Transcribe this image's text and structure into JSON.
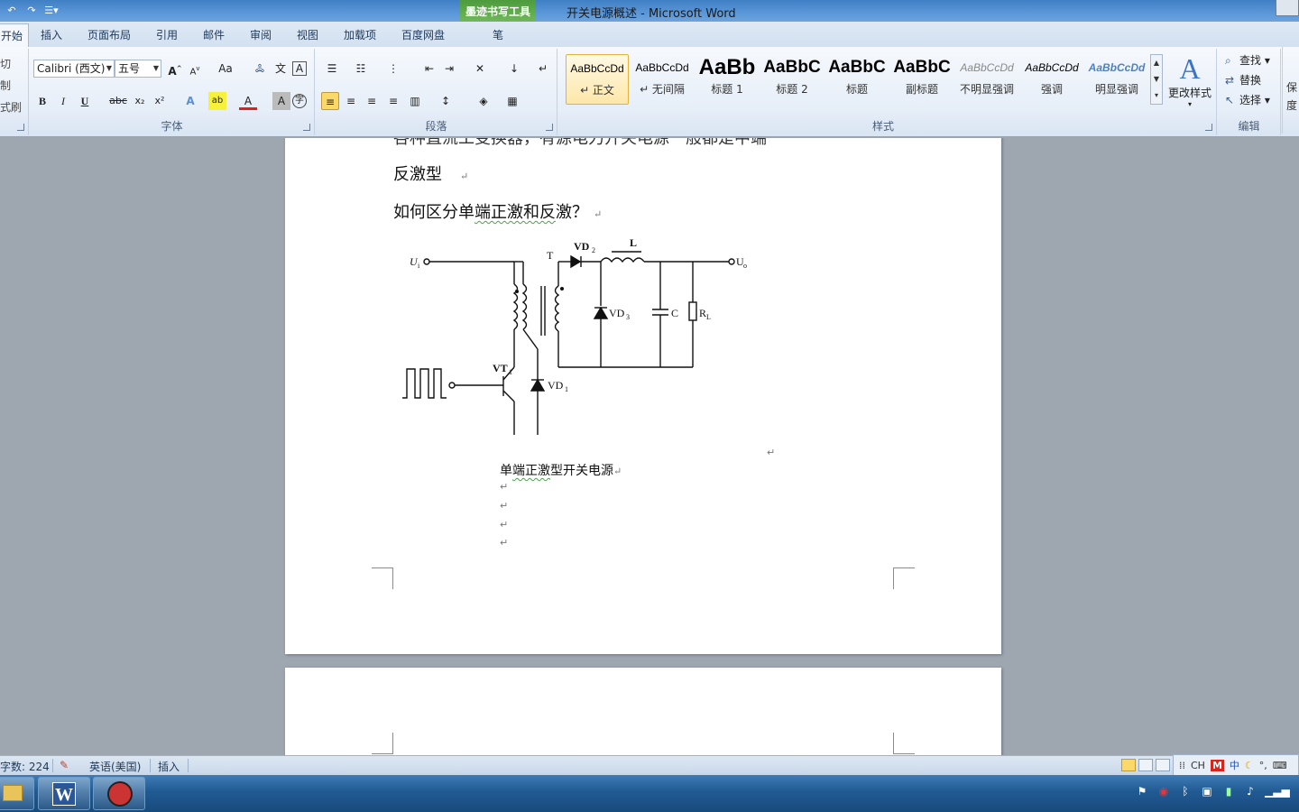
{
  "window": {
    "title": "开关电源概述 - Microsoft Word",
    "context_tool": "墨迹书写工具",
    "context_tab": "笔"
  },
  "tabs": [
    "开始",
    "插入",
    "页面布局",
    "引用",
    "邮件",
    "审阅",
    "视图",
    "加载项",
    "百度网盘"
  ],
  "clipboard": {
    "cut": "切",
    "copy": "制",
    "format_painter": "式刷"
  },
  "font": {
    "family": "Calibri (西文)",
    "size": "五号",
    "grow": "A",
    "shrink": "A",
    "case": "Aa",
    "bold": "B",
    "italic": "I",
    "underline": "U",
    "strike": "abc",
    "subscript": "x₂",
    "superscript": "x²",
    "group_label": "字体"
  },
  "paragraph": {
    "group_label": "段落"
  },
  "styles": {
    "group_label": "样式",
    "items": [
      {
        "sample": "AaBbCcDd",
        "name": "↵ 正文"
      },
      {
        "sample": "AaBbCcDd",
        "name": "↵ 无间隔"
      },
      {
        "sample": "AaBb",
        "name": "标题 1"
      },
      {
        "sample": "AaBbC",
        "name": "标题 2"
      },
      {
        "sample": "AaBbC",
        "name": "标题"
      },
      {
        "sample": "AaBbC",
        "name": "副标题"
      },
      {
        "sample": "AaBbCcDd",
        "name": "不明显强调"
      },
      {
        "sample": "AaBbCcDd",
        "name": "强调"
      },
      {
        "sample": "AaBbCcDd",
        "name": "明显强调"
      }
    ],
    "change_styles": "更改样式"
  },
  "editing": {
    "find": "查找",
    "replace": "替换",
    "select": "选择",
    "group_label": "编辑"
  },
  "right_cut": [
    "保",
    "度"
  ],
  "document": {
    "clipped_line": "各种直流工变换器，有源电力开关电源一般都是中端",
    "line1": "反激型",
    "line2_pre": "如何区分单",
    "line2_spell": "端正激和反",
    "line2_post": "激？",
    "caption_pre": "单",
    "caption_spell": "端正激",
    "caption_post": "型开关电源",
    "circuit": {
      "ui": "U",
      "ui_sub": "i",
      "uo": "U",
      "uo_sub": "o",
      "T": "T",
      "L": "L",
      "C": "C",
      "VD2": "VD",
      "VD2_sub": "2",
      "VD3": "VD",
      "VD3_sub": "3",
      "VD1": "VD",
      "VD1_sub": "1",
      "VT1": "VT",
      "VT1_sub": "1",
      "RL": "R",
      "RL_sub": "L"
    }
  },
  "status": {
    "word_count": "字数: 224",
    "language": "英语(美国)",
    "mode": "插入"
  },
  "ime": {
    "lang": "CH",
    "ime_mode": "中"
  },
  "colors": {
    "titlebar": "#4a88ce",
    "context_green": "#6fb85a",
    "taskbar": "#215a93",
    "highlight": "#fbd86a"
  }
}
